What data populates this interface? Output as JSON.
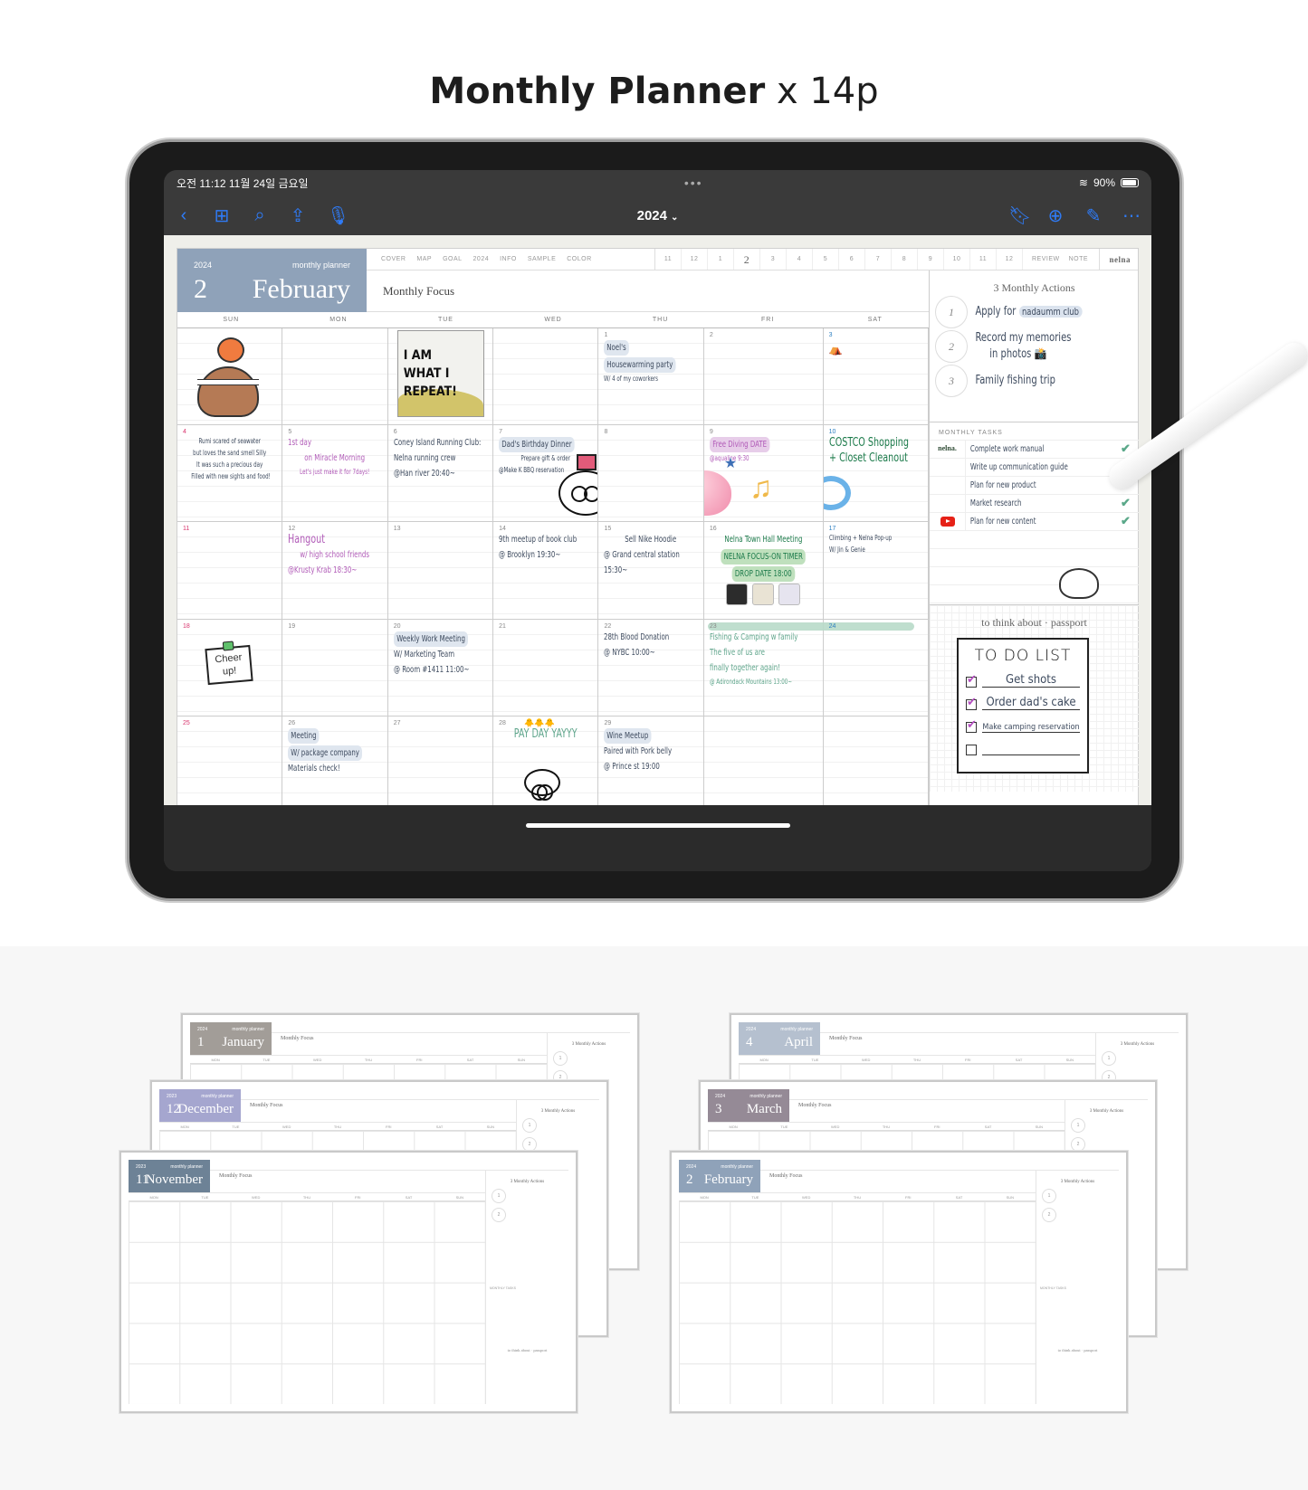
{
  "page": {
    "title_bold": "Monthly Planner",
    "title_light": "x 14p"
  },
  "statusbar": {
    "time_date": "오전 11:12   11월 24일 금요일",
    "dots": "•••",
    "battery": "90%"
  },
  "toolbar": {
    "title": "2024",
    "left_icons": [
      "back-icon",
      "grid-icon",
      "search-icon",
      "share-icon",
      "microphone-icon"
    ],
    "right_icons": [
      "bookmark-icon",
      "add-page-icon",
      "edit-icon",
      "more-icon"
    ]
  },
  "planner": {
    "year": "2024",
    "subtitle": "monthly planner",
    "month_number": "2",
    "month_name": "February",
    "nav_links": [
      "COVER",
      "MAP",
      "GOAL",
      "2024",
      "INFO",
      "SAMPLE",
      "COLOR"
    ],
    "nav_months": [
      "11",
      "12",
      "1",
      "2",
      "3",
      "4",
      "5",
      "6",
      "7",
      "8",
      "9",
      "10",
      "11",
      "12"
    ],
    "nav_current_month": "2",
    "nav_extra": [
      "REVIEW",
      "NOTE"
    ],
    "brand": "nelna",
    "focus_label": "Monthly Focus",
    "weekdays": [
      "SUN",
      "MON",
      "TUE",
      "WED",
      "THU",
      "FRI",
      "SAT"
    ],
    "cells": [
      {
        "day": "",
        "events": []
      },
      {
        "day": "",
        "events": []
      },
      {
        "day": "",
        "sticker": "I AM WHAT I REPEAT!",
        "events": []
      },
      {
        "day": "",
        "events": []
      },
      {
        "day": "1",
        "events": [
          "Noel's",
          "Housewarming party",
          "W/ 4 of my coworkers"
        ]
      },
      {
        "day": "2",
        "events": []
      },
      {
        "day": "3",
        "events": []
      },
      {
        "day": "4",
        "events": [
          "Rumi scared of seawater",
          "but loves the sand smell Silly",
          "It was such a precious day",
          "Filled with new sights and food!"
        ]
      },
      {
        "day": "5",
        "events": [
          "1st day",
          "on Miracle Morning",
          "Let's just make it for 7days!"
        ]
      },
      {
        "day": "6",
        "events": [
          "Coney Island Running Club:",
          "Nelna running crew",
          "@Han river 20:40~"
        ]
      },
      {
        "day": "7",
        "events": [
          "Dad's Birthday Dinner",
          "Prepare gift & order",
          "@Make K BBQ reservation"
        ]
      },
      {
        "day": "8",
        "events": []
      },
      {
        "day": "9",
        "events": [
          "Free Diving DATE",
          "@aqualine 9:30"
        ]
      },
      {
        "day": "10",
        "events": [
          "COSTCO Shopping",
          "+ Closet Cleanout"
        ]
      },
      {
        "day": "11",
        "events": []
      },
      {
        "day": "12",
        "events": [
          "Hangout",
          "w/ high school friends",
          "@Krusty Krab 18:30~"
        ]
      },
      {
        "day": "13",
        "events": []
      },
      {
        "day": "14",
        "events": [
          "9th meetup of book club",
          "@ Brooklyn 19:30~"
        ]
      },
      {
        "day": "15",
        "events": [
          "Sell Nike Hoodie",
          "@ Grand central station",
          "15:30~"
        ]
      },
      {
        "day": "16",
        "events": [
          "Nelna Town Hall Meeting",
          "NELNA FOCUS-ON TIMER",
          "DROP DATE 18:00"
        ]
      },
      {
        "day": "17",
        "events": [
          "Climbing + Nelna Pop-up",
          "W/ Jin & Genie"
        ]
      },
      {
        "day": "18",
        "sticker": "Cheer up!",
        "events": []
      },
      {
        "day": "19",
        "events": []
      },
      {
        "day": "20",
        "events": [
          "Weekly Work Meeting",
          "W/ Marketing Team",
          "@ Room #1411 11:00~"
        ]
      },
      {
        "day": "21",
        "events": []
      },
      {
        "day": "22",
        "events": [
          "28th Blood Donation",
          "@ NYBC 10:00~"
        ]
      },
      {
        "day": "23",
        "events": [
          "Fishing & Camping w family",
          "The five of us are",
          "finally together again!",
          "@ Adirondack Mountains 13:00~"
        ]
      },
      {
        "day": "24",
        "events": []
      },
      {
        "day": "25",
        "events": []
      },
      {
        "day": "26",
        "events": [
          "Meeting",
          "W/ package company",
          "Materials check!"
        ]
      },
      {
        "day": "27",
        "events": []
      },
      {
        "day": "28",
        "events": [
          "PAY DAY YAYYY"
        ]
      },
      {
        "day": "29",
        "events": [
          "Wine Meetup",
          "Paired with Pork belly",
          "@ Prince st 19:00"
        ]
      },
      {
        "day": "",
        "events": []
      },
      {
        "day": "",
        "events": []
      }
    ],
    "monthly_actions": {
      "title": "3 Monthly Actions",
      "items": [
        {
          "num": "1",
          "text": "Apply for",
          "highlight": "nadaumm club"
        },
        {
          "num": "2",
          "text": "Record my memories",
          "text2": "in photos"
        },
        {
          "num": "3",
          "text": "Family fishing trip"
        }
      ]
    },
    "monthly_tasks": {
      "label": "MONTHLY TASKS",
      "items": [
        {
          "tag": "nelna.",
          "text": "Complete work manual",
          "done": true
        },
        {
          "tag": "",
          "text": "Write up communication guide",
          "done": true
        },
        {
          "tag": "",
          "text": "Plan for new product",
          "done": true
        },
        {
          "tag": "",
          "text": "Market research",
          "done": true
        },
        {
          "tag": "youtube",
          "text": "Plan for new content",
          "done": true
        }
      ],
      "check_glyph": "✔"
    },
    "think": {
      "title": "to think about  ·  passport",
      "todo_title": "TO DO LIST",
      "items": [
        {
          "text": "Get shots",
          "checked": true
        },
        {
          "text": "Order dad's cake",
          "checked": true
        },
        {
          "text": "Make camping reservation",
          "checked": true
        },
        {
          "text": "",
          "checked": false
        }
      ]
    }
  },
  "thumbnails": [
    {
      "year": "2024",
      "num": "1",
      "name": "January",
      "color": "#a29d98",
      "days": [
        "MON",
        "TUE",
        "WED",
        "THU",
        "FRI",
        "SAT",
        "SUN"
      ]
    },
    {
      "year": "2023",
      "num": "12",
      "name": "December",
      "color": "#a5a6cf",
      "days": [
        "MON",
        "TUE",
        "WED",
        "THU",
        "FRI",
        "SAT",
        "SUN"
      ]
    },
    {
      "year": "2023",
      "num": "11",
      "name": "November",
      "color": "#6d8296",
      "days": [
        "MON",
        "TUE",
        "WED",
        "THU",
        "FRI",
        "SAT",
        "SUN"
      ]
    },
    {
      "year": "2024",
      "num": "4",
      "name": "April",
      "color": "#b5c0cf",
      "days": [
        "MON",
        "TUE",
        "WED",
        "THU",
        "FRI",
        "SAT",
        "SUN"
      ]
    },
    {
      "year": "2024",
      "num": "3",
      "name": "March",
      "color": "#958a96",
      "days": [
        "MON",
        "TUE",
        "WED",
        "THU",
        "FRI",
        "SAT",
        "SUN"
      ]
    },
    {
      "year": "2024",
      "num": "2",
      "name": "February",
      "color": "#8fa2b9",
      "days": [
        "MON",
        "TUE",
        "WED",
        "THU",
        "FRI",
        "SAT",
        "SUN"
      ]
    }
  ],
  "thumbnail_labels": {
    "subtitle": "monthly planner",
    "focus": "Monthly Focus",
    "actions": "3 Monthly Actions",
    "tasks": "MONTHLY TASKS",
    "think": "to think about · passport"
  }
}
